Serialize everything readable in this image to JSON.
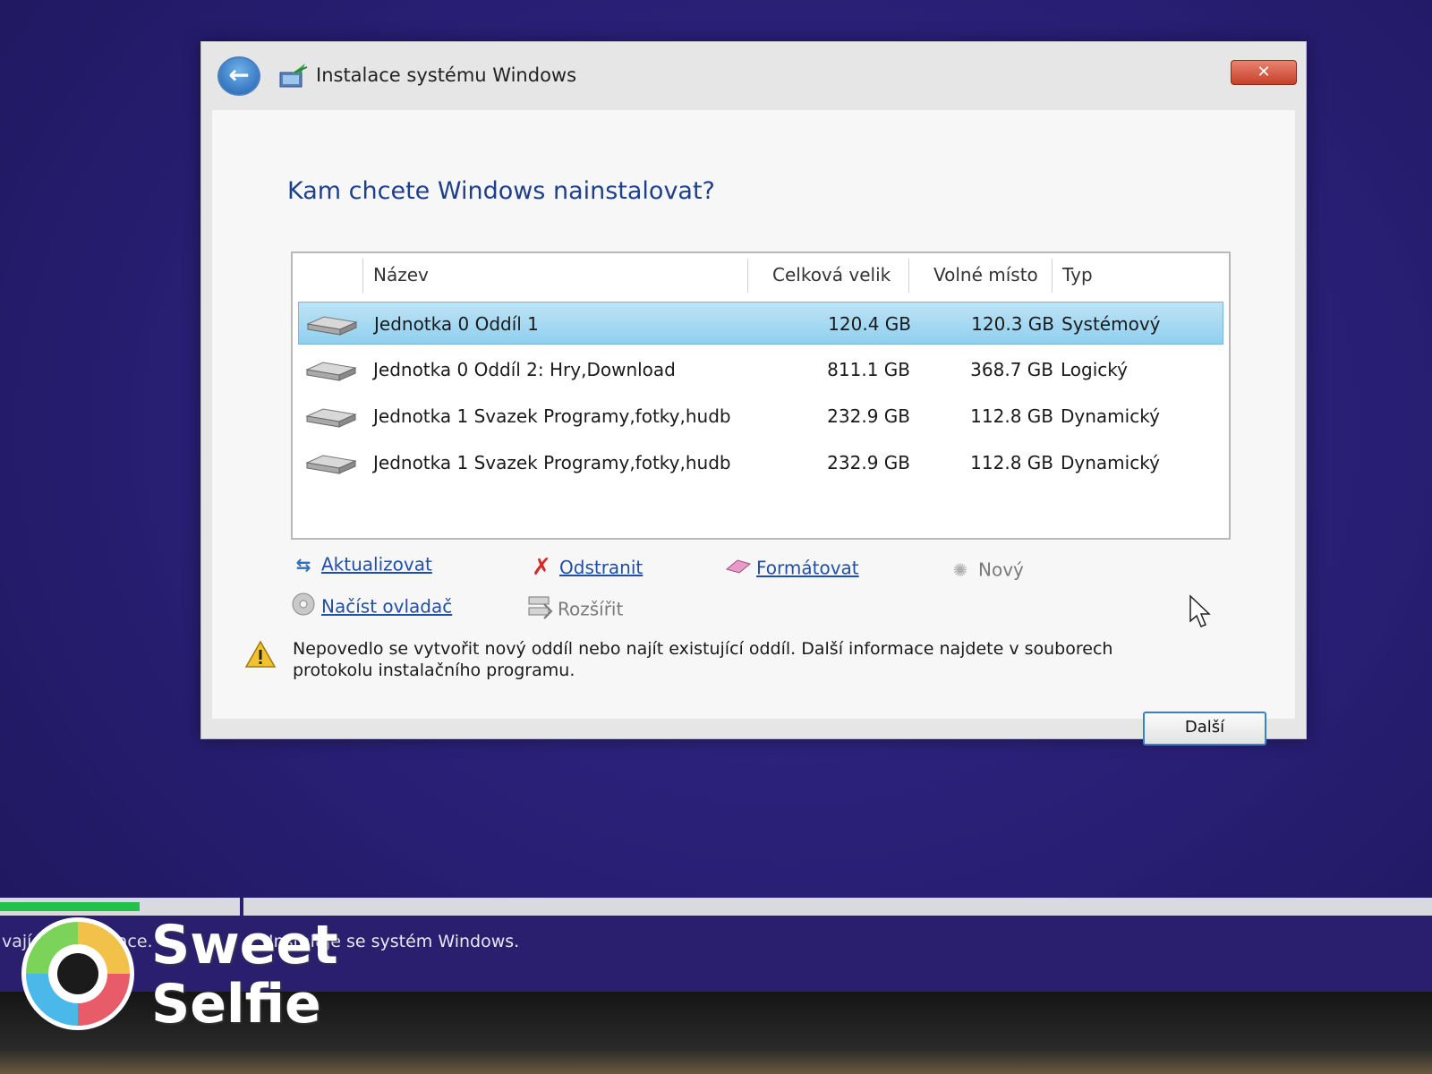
{
  "dialog": {
    "title": "Instalace systému Windows",
    "close_label": "✕",
    "heading": "Kam chcete Windows nainstalovat?"
  },
  "table": {
    "columns": [
      "Název",
      "Celková velik",
      "Volné místo",
      "Typ"
    ],
    "rows": [
      {
        "name": "Jednotka 0 Oddíl 1",
        "size": "120.4 GB",
        "free": "120.3 GB",
        "type": "Systémový",
        "selected": true
      },
      {
        "name": "Jednotka 0 Oddíl 2: Hry,Download",
        "size": "811.1 GB",
        "free": "368.7 GB",
        "type": "Logický",
        "selected": false
      },
      {
        "name": "Jednotka 1 Svazek  Programy,fotky,hudb",
        "size": "232.9 GB",
        "free": "112.8 GB",
        "type": "Dynamický",
        "selected": false
      },
      {
        "name": "Jednotka 1 Svazek  Programy,fotky,hudb",
        "size": "232.9 GB",
        "free": "112.8 GB",
        "type": "Dynamický",
        "selected": false
      }
    ]
  },
  "actions": {
    "refresh": "Aktualizovat",
    "delete": "Odstranit",
    "format": "Formátovat",
    "new": "Nový",
    "load_driver": "Načíst ovladač",
    "extend": "Rozšířit"
  },
  "warning": "Nepovedlo se vytvořit nový oddíl nebo najít existující oddíl. Další informace najdete v souborech protokolu instalačního programu.",
  "next_label": "Další",
  "status": {
    "left": "vají se informace.",
    "right": "Instaluje se systém Windows."
  },
  "watermark": {
    "line1": "Sweet",
    "line2": "Selfie"
  },
  "colors": {
    "background": "#2a1f6e",
    "heading": "#1e3f8a",
    "link": "#1f4fa8",
    "selection": "#8fd0ef",
    "progress_done": "#22c24a"
  }
}
